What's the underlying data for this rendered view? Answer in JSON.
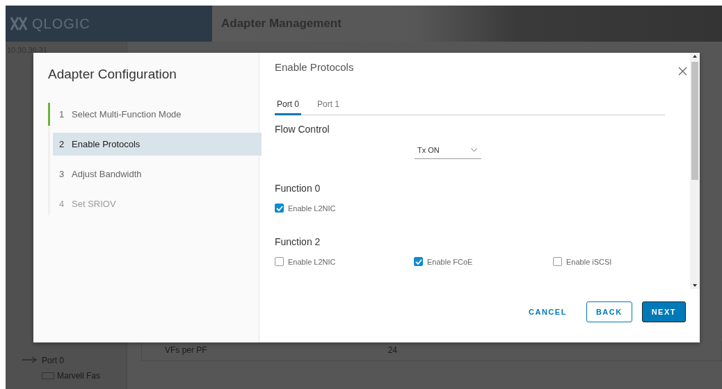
{
  "app": {
    "logo": "QLOGIC",
    "title": "Adapter Management",
    "tree": {
      "host": "10.30.36.31",
      "port": "Port 0",
      "adapter": "Marvell Fas"
    },
    "detail": {
      "label": "VFs per PF",
      "value": "24"
    }
  },
  "dialog": {
    "title": "Adapter Configuration",
    "steps": [
      {
        "number": "1",
        "label": "Select Multi-Function Mode",
        "completed": true,
        "selected": false,
        "disabled": false
      },
      {
        "number": "2",
        "label": "Enable Protocols",
        "completed": false,
        "selected": true,
        "disabled": false
      },
      {
        "number": "3",
        "label": "Adjust Bandwidth",
        "completed": false,
        "selected": false,
        "disabled": false
      },
      {
        "number": "4",
        "label": "Set SRIOV",
        "completed": false,
        "selected": false,
        "disabled": true
      }
    ],
    "page_title": "Enable Protocols",
    "tabs": [
      {
        "label": "Port 0",
        "selected": true
      },
      {
        "label": "Port 1",
        "selected": false
      }
    ],
    "flow_control": {
      "label": "Flow Control",
      "value": "Tx ON"
    },
    "functions": [
      {
        "title": "Function 0",
        "options": [
          {
            "label": "Enable L2NIC",
            "checked": true
          }
        ]
      },
      {
        "title": "Function 2",
        "options": [
          {
            "label": "Enable L2NIC",
            "checked": false
          },
          {
            "label": "Enable FCoE",
            "checked": true
          },
          {
            "label": "Enable iSCSI",
            "checked": false
          }
        ]
      }
    ],
    "buttons": [
      {
        "label": "CANCEL",
        "kind": "flat"
      },
      {
        "label": "BACK",
        "kind": "outline"
      },
      {
        "label": "NEXT",
        "kind": "primary"
      }
    ]
  }
}
